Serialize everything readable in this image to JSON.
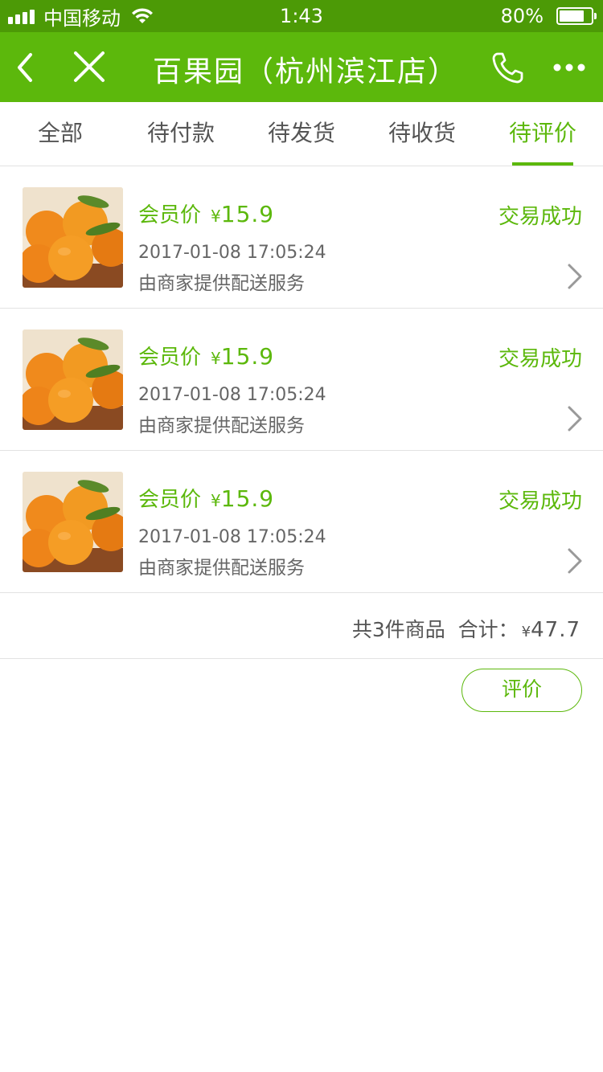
{
  "status_bar": {
    "carrier": "中国移动",
    "time": "1:43",
    "battery_percent": "80%",
    "battery_level": 0.8,
    "signal_bars": 4
  },
  "nav": {
    "title": "百果园（杭州滨江店）",
    "icons": [
      "back-icon",
      "close-icon",
      "phone-icon",
      "more-icon"
    ]
  },
  "tabs": [
    {
      "label": "全部",
      "active": false
    },
    {
      "label": "待付款",
      "active": false
    },
    {
      "label": "待发货",
      "active": false
    },
    {
      "label": "待收货",
      "active": false
    },
    {
      "label": "待评价",
      "active": true
    }
  ],
  "orders": [
    {
      "price_label": "会员价",
      "currency": "¥",
      "price": "15.9",
      "status": "交易成功",
      "date": "2017-01-08  17:05:24",
      "delivery": "由商家提供配送服务"
    },
    {
      "price_label": "会员价",
      "currency": "¥",
      "price": "15.9",
      "status": "交易成功",
      "date": "2017-01-08  17:05:24",
      "delivery": "由商家提供配送服务"
    },
    {
      "price_label": "会员价",
      "currency": "¥",
      "price": "15.9",
      "status": "交易成功",
      "date": "2017-01-08  17:05:24",
      "delivery": "由商家提供配送服务"
    }
  ],
  "summary": {
    "count_text": "共3件商品",
    "total_label": "合计：",
    "currency": "¥",
    "total": "47.7"
  },
  "review_button": "评价",
  "colors": {
    "brand_green": "#5cb80c",
    "status_bar": "#4c9a06",
    "text_gray": "#666666"
  }
}
